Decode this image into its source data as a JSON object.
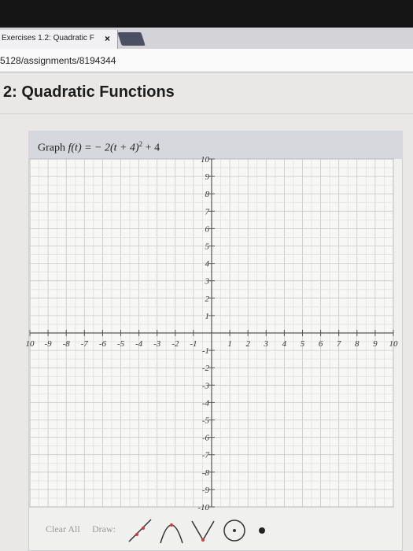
{
  "browser": {
    "tab_title": "Exercises 1.2: Quadratic F",
    "tab_close": "×",
    "url": "5128/assignments/8194344"
  },
  "page": {
    "title": "2: Quadratic Functions"
  },
  "graph": {
    "prompt_prefix": "Graph",
    "prompt_func": "f(t) = − 2(t + 4)",
    "prompt_exponent": "2",
    "prompt_suffix": "+ 4",
    "x_ticks": [
      "10",
      "-9",
      "-8",
      "-7",
      "-6",
      "-5",
      "-4",
      "-3",
      "-2",
      "-1",
      "1",
      "2",
      "3",
      "4",
      "5",
      "6",
      "7",
      "8",
      "9",
      "10"
    ],
    "y_ticks_pos": [
      "10",
      "9",
      "8",
      "7",
      "6",
      "5",
      "4",
      "3",
      "2",
      "1"
    ],
    "y_ticks_neg": [
      "-1",
      "-2",
      "-3",
      "-4",
      "-5",
      "-6",
      "-7",
      "-8",
      "-9",
      "-10"
    ],
    "x_range": [
      -10,
      10
    ],
    "y_range": [
      -10,
      10
    ],
    "grid": true
  },
  "toolbar": {
    "clear_all": "Clear All",
    "draw": "Draw:",
    "tools": [
      "line-tool-icon",
      "parabola-tool-icon",
      "absolute-value-tool-icon",
      "circle-tool-icon",
      "point-tool-icon"
    ]
  }
}
